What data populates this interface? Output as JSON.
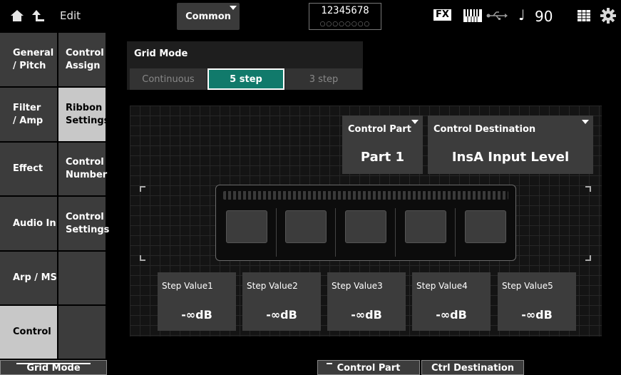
{
  "topbar": {
    "edit_label": "Edit",
    "common_label": "Common",
    "parts_numbers": "12345678",
    "parts_dots": "○○○○○○○○",
    "fx_label": "FX",
    "tempo": "90"
  },
  "categories": [
    {
      "label_1": "General",
      "label_2": "/ Pitch"
    },
    {
      "label_1": "Filter",
      "label_2": "/ Amp"
    },
    {
      "label_1": "Effect",
      "label_2": ""
    },
    {
      "label_1": "Audio In",
      "label_2": ""
    },
    {
      "label_1": "Arp / MS",
      "label_2": ""
    },
    {
      "label_1": "Control",
      "label_2": ""
    }
  ],
  "subcategories": [
    {
      "label_1": "Control",
      "label_2": "Assign"
    },
    {
      "label_1": "Ribbon",
      "label_2": "Settings"
    },
    {
      "label_1": "Control",
      "label_2": "Number"
    },
    {
      "label_1": "Control",
      "label_2": "Settings"
    }
  ],
  "grid_mode": {
    "title": "Grid Mode",
    "options": [
      "Continuous",
      "5 step",
      "3 step"
    ],
    "selected": "5 step"
  },
  "control_part": {
    "title": "Control Part",
    "value": "Part 1"
  },
  "control_destination": {
    "title": "Control Destination",
    "value": "InsA Input Level"
  },
  "steps": [
    {
      "title": "Step Value1",
      "value": "-∞dB"
    },
    {
      "title": "Step Value2",
      "value": "-∞dB"
    },
    {
      "title": "Step Value3",
      "value": "-∞dB"
    },
    {
      "title": "Step Value4",
      "value": "-∞dB"
    },
    {
      "title": "Step Value5",
      "value": "-∞dB"
    }
  ],
  "bottom": {
    "grid_mode": "Grid Mode",
    "control_part": "Control Part",
    "ctrl_destination": "Ctrl Destination"
  },
  "colors": {
    "accent_selected": "#117a6b",
    "panel": "#3c3c3c",
    "active_tab": "#c8c8c8"
  }
}
